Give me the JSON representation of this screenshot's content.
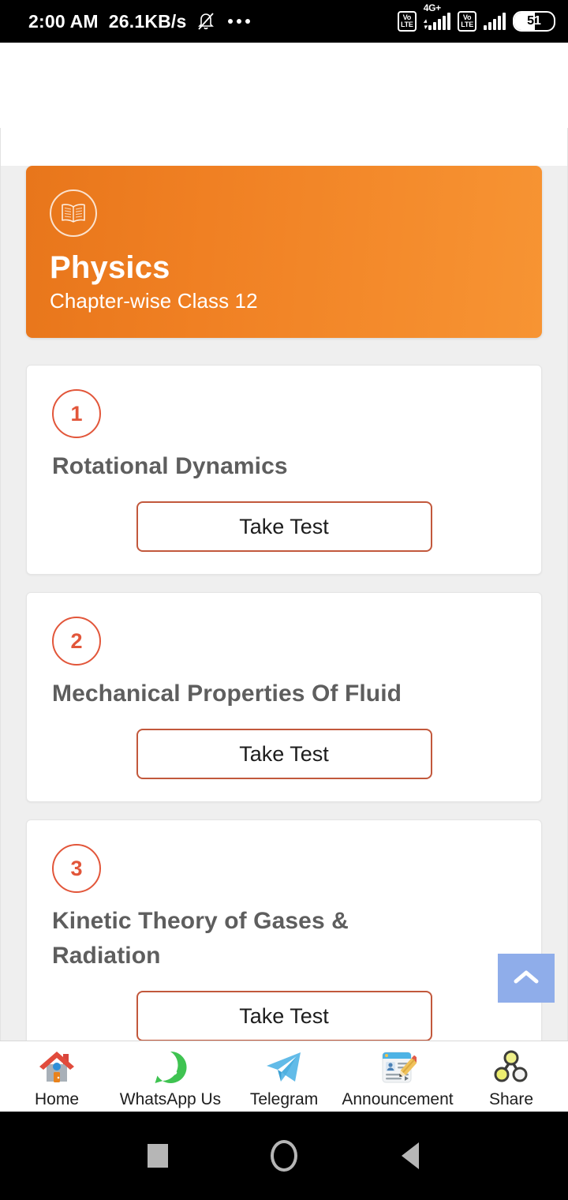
{
  "status_bar": {
    "time": "2:00 AM",
    "network_speed": "26.1KB/s",
    "mute_icon": "bell-muted-icon",
    "overflow_icon": "more-dots-icon",
    "sim1_volte": "VoLTE",
    "sim1_network": "4G+",
    "sim2_volte": "VoLTE",
    "battery_level": "51"
  },
  "subject": {
    "icon": "open-book-icon",
    "title": "Physics",
    "subtitle": "Chapter-wise Class 12"
  },
  "chapters": [
    {
      "number": "1",
      "title": "Rotational Dynamics",
      "button_label": "Take Test"
    },
    {
      "number": "2",
      "title": "Mechanical Properties Of Fluid",
      "button_label": "Take Test"
    },
    {
      "number": "3",
      "title": "Kinetic Theory of Gases & Radiation",
      "button_label": "Take Test"
    }
  ],
  "scroll_top": {
    "icon": "chevron-up-icon",
    "color": "#8fadea"
  },
  "bottom_nav": [
    {
      "label": "Home",
      "icon": "house-icon"
    },
    {
      "label": "WhatsApp Us",
      "icon": "whatsapp-icon"
    },
    {
      "label": "Telegram",
      "icon": "telegram-icon"
    },
    {
      "label": "Announcement",
      "icon": "announcement-icon"
    },
    {
      "label": "Share",
      "icon": "share-nodes-icon"
    }
  ],
  "system_nav": [
    {
      "label": "Recents",
      "icon": "square-icon"
    },
    {
      "label": "Home",
      "icon": "circle-icon"
    },
    {
      "label": "Back",
      "icon": "triangle-back-icon"
    }
  ],
  "theme": {
    "accent_orange": "#f08023",
    "accent_red": "#e2563a",
    "button_border": "#c2583c",
    "page_bg": "#efefef"
  }
}
